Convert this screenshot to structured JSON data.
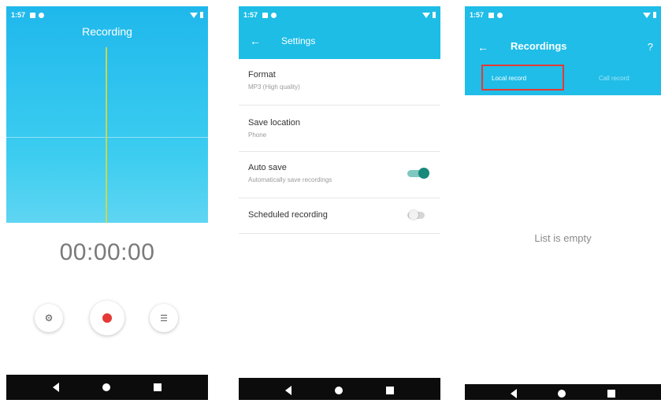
{
  "status_bar": {
    "time": "1:57"
  },
  "recorder": {
    "title": "Recording",
    "timer": "00:00:00",
    "settings_icon": "gear-icon",
    "record_icon": "record-icon",
    "list_icon": "list-icon"
  },
  "settings": {
    "title": "Settings",
    "items": [
      {
        "title": "Format",
        "subtitle": "MP3 (High quality)"
      },
      {
        "title": "Save location",
        "subtitle": "Phone"
      },
      {
        "title": "Auto save",
        "subtitle": "Automatically save recordings",
        "toggle": true
      },
      {
        "title": "Scheduled recording",
        "subtitle": "",
        "toggle": false
      }
    ]
  },
  "recordings": {
    "title": "Recordings",
    "help": "?",
    "tabs": [
      "Local record",
      "Call record"
    ],
    "empty_text": "List is empty"
  },
  "colors": {
    "accent": "#1fbde8",
    "toggle_on": "#18897a",
    "record": "#e53935",
    "highlight": "#e53935"
  }
}
